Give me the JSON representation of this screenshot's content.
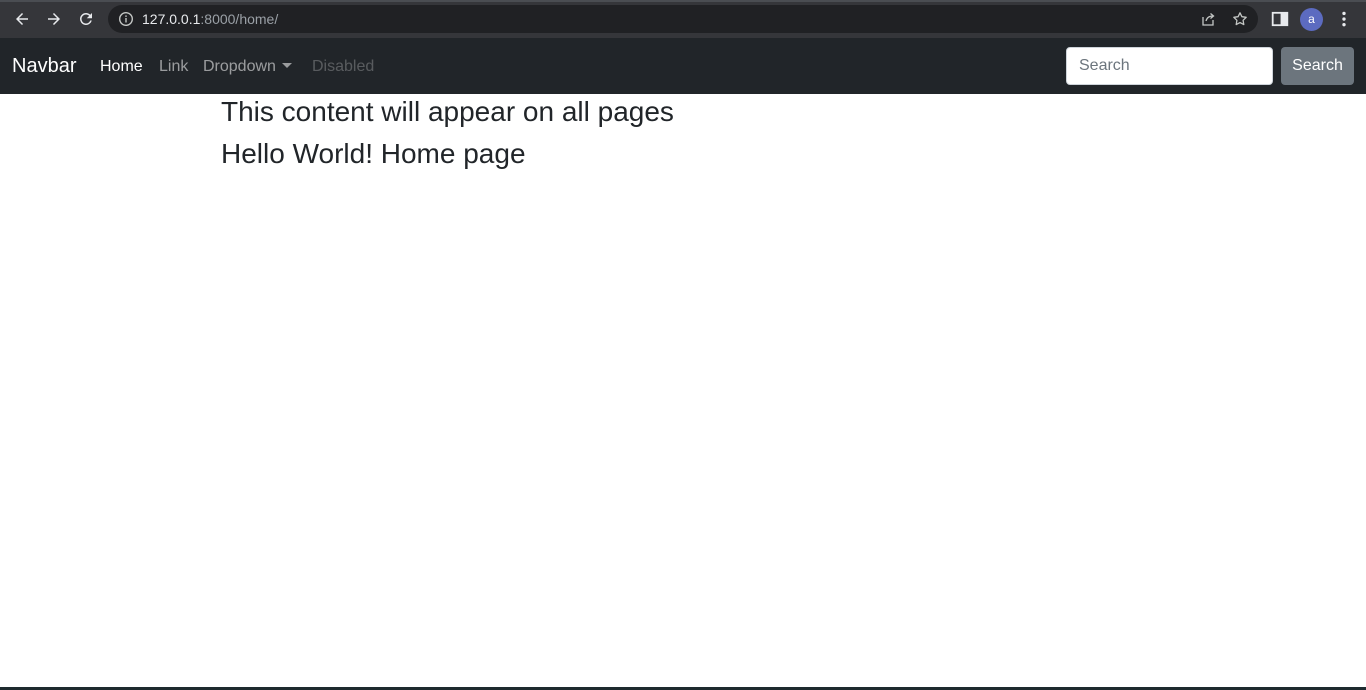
{
  "browser": {
    "url_host": "127.0.0.1",
    "url_rest": ":8000/home/",
    "avatar_letter": "a"
  },
  "navbar": {
    "brand": "Navbar",
    "links": [
      {
        "label": "Home",
        "state": "active"
      },
      {
        "label": "Link",
        "state": "normal"
      },
      {
        "label": "Dropdown",
        "state": "normal"
      },
      {
        "label": "Disabled",
        "state": "disabled"
      }
    ],
    "search_placeholder": "Search",
    "search_button": "Search",
    "colors": {
      "background": "#212529",
      "button": "#6c757d"
    }
  },
  "content": {
    "line1": "This content will appear on all pages",
    "line2": "Hello World! Home page"
  }
}
